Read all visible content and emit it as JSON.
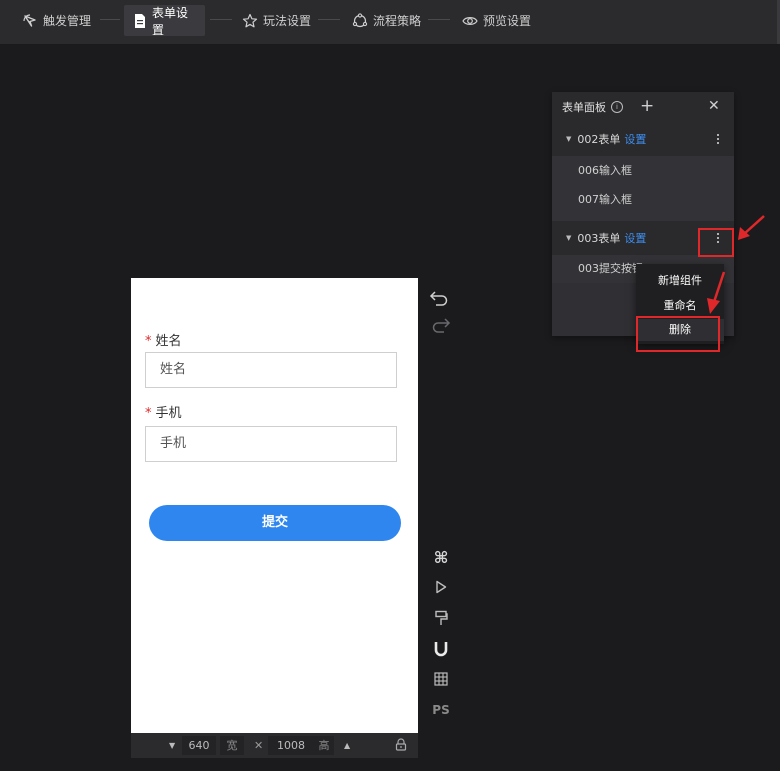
{
  "steps": [
    {
      "label": "触发管理",
      "icon": "trigger-icon"
    },
    {
      "label": "表单设置",
      "icon": "document-icon",
      "active": true
    },
    {
      "label": "玩法设置",
      "icon": "star-icon"
    },
    {
      "label": "流程策略",
      "icon": "flow-icon"
    },
    {
      "label": "预览设置",
      "icon": "eye-icon"
    }
  ],
  "panel": {
    "title": "表单面板",
    "info_icon": "i",
    "add_icon": "+",
    "close_icon": "✕",
    "groups": [
      {
        "name": "002表单",
        "link": "设置",
        "children": [
          "006输入框",
          "007输入框"
        ]
      },
      {
        "name": "003表单",
        "link": "设置",
        "children": [
          "003提交按钮"
        ]
      }
    ]
  },
  "context_menu": {
    "items": [
      "新增组件",
      "重命名",
      "删除"
    ]
  },
  "form": {
    "fields": [
      {
        "label": "姓名",
        "required": "*",
        "placeholder": "姓名"
      },
      {
        "label": "手机",
        "required": "*",
        "placeholder": "手机"
      }
    ],
    "submit_label": "提交"
  },
  "canvas": {
    "width": "640",
    "width_unit": "宽",
    "times": "✕",
    "height": "1008",
    "height_unit": "高"
  },
  "tools": {
    "ps_label": "PS"
  },
  "colors": {
    "accent": "#2e86ee",
    "highlight": "#e0282a",
    "link": "#3d8ef0"
  }
}
